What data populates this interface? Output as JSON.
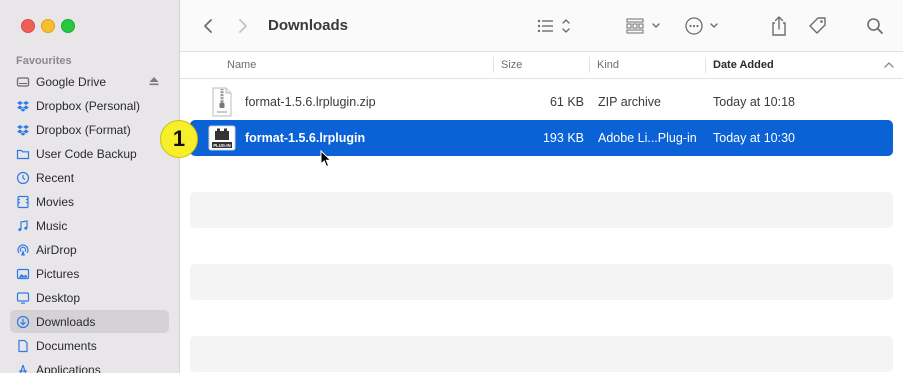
{
  "window": {
    "title": "Downloads"
  },
  "sidebar": {
    "section_title": "Favourites",
    "items": [
      {
        "label": "Google Drive",
        "icon": "google-drive-icon"
      },
      {
        "label": "Dropbox (Personal)",
        "icon": "dropbox-icon"
      },
      {
        "label": "Dropbox (Format)",
        "icon": "dropbox-icon"
      },
      {
        "label": "User Code Backup",
        "icon": "folder-icon"
      },
      {
        "label": "Recent",
        "icon": "clock-icon"
      },
      {
        "label": "Movies",
        "icon": "film-icon"
      },
      {
        "label": "Music",
        "icon": "music-note-icon"
      },
      {
        "label": "AirDrop",
        "icon": "airdrop-icon"
      },
      {
        "label": "Pictures",
        "icon": "photo-icon"
      },
      {
        "label": "Desktop",
        "icon": "desktop-icon"
      },
      {
        "label": "Downloads",
        "icon": "download-icon"
      },
      {
        "label": "Documents",
        "icon": "document-icon"
      },
      {
        "label": "Applications",
        "icon": "applications-icon"
      }
    ],
    "active_index": 10
  },
  "columns": {
    "name": "Name",
    "size": "Size",
    "kind": "Kind",
    "date": "Date Added"
  },
  "files": [
    {
      "name": "format-1.5.6.lrplugin.zip",
      "size": "61 KB",
      "kind": "ZIP archive",
      "date": "Today at 10:18",
      "icon": "zip-file-icon"
    },
    {
      "name": "format-1.5.6.lrplugin",
      "size": "193 KB",
      "kind": "Adobe Li...Plug-in",
      "date": "Today at 10:30",
      "icon": "plugin-file-icon",
      "selected": true
    }
  ],
  "annotation": {
    "step": "1"
  },
  "colors": {
    "selection": "#0a62d6",
    "accent": "#2f7be6",
    "badge": "#f7ef2a"
  }
}
